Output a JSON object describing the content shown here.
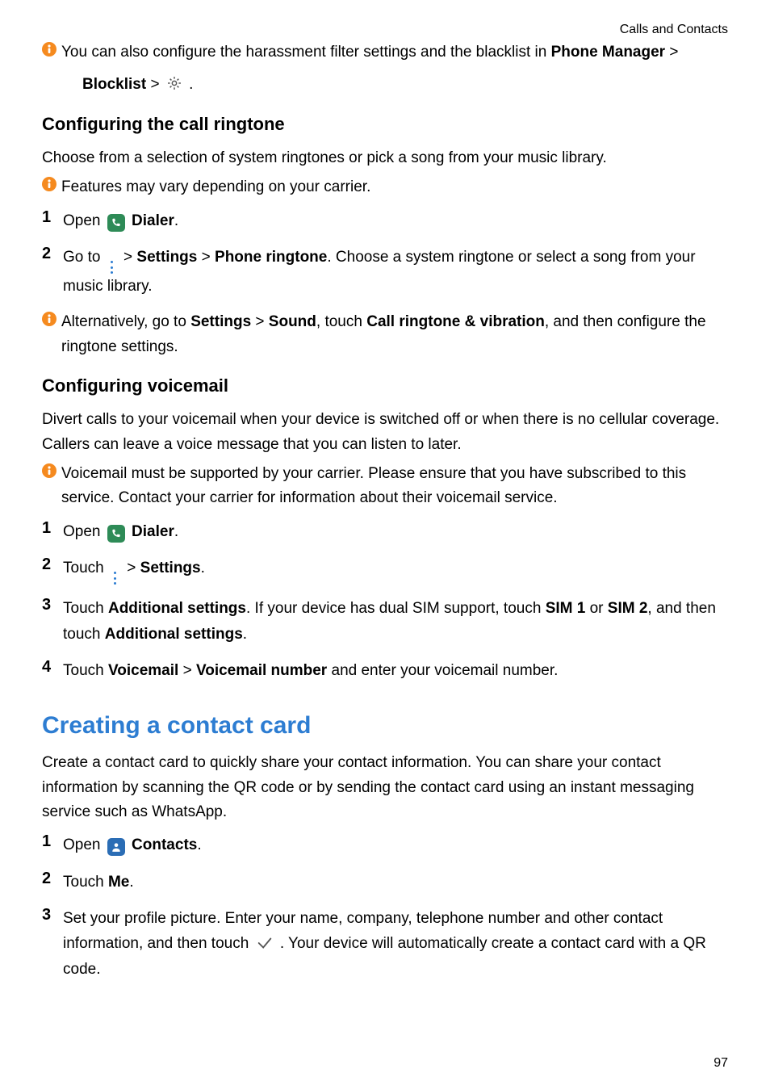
{
  "header": {
    "chapter": "Calls and Contacts"
  },
  "tip1": {
    "pre": "You can also configure the harassment filter settings and the blacklist in ",
    "b1": "Phone Manager",
    "sep1": " > ",
    "b2": "Blocklist",
    "sep2": " > ",
    "post": " ."
  },
  "ringtone": {
    "heading": "Configuring the call ringtone",
    "intro": "Choose from a selection of system ringtones or pick a song from your music library.",
    "tip": "Features may vary depending on your carrier.",
    "step1": {
      "pre": "Open ",
      "b": "Dialer",
      "post": "."
    },
    "step2": {
      "pre": "Go to ",
      "b1": "Settings",
      "b2": "Phone ringtone",
      "post": ". Choose a system ringtone or select a song from your music library."
    },
    "tip2": {
      "pre": "Alternatively, go to ",
      "b1": "Settings",
      "sep": " > ",
      "b2": "Sound",
      "mid": ", touch ",
      "b3": "Call ringtone & vibration",
      "post": ", and then configure the ringtone settings."
    }
  },
  "voicemail": {
    "heading": "Configuring voicemail",
    "intro": "Divert calls to your voicemail when your device is switched off or when there is no cellular coverage. Callers can leave a voice message that you can listen to later.",
    "tip": "Voicemail must be supported by your carrier. Please ensure that you have subscribed to this service. Contact your carrier for information about their voicemail service.",
    "step1": {
      "pre": "Open ",
      "b": "Dialer",
      "post": "."
    },
    "step2": {
      "pre": "Touch ",
      "b": "Settings",
      "post": "."
    },
    "step3": {
      "pre": "Touch ",
      "b1": "Additional settings",
      "mid": ". If your device has dual SIM support, touch ",
      "b2": "SIM 1",
      "or": " or ",
      "b3": "SIM 2",
      "mid2": ", and then touch ",
      "b4": "Additional settings",
      "post": "."
    },
    "step4": {
      "pre": "Touch ",
      "b1": "Voicemail",
      "sep": " > ",
      "b2": "Voicemail number",
      "post": " and enter your voicemail number."
    }
  },
  "contactCard": {
    "heading": "Creating a contact card",
    "intro": "Create a contact card to quickly share your contact information. You can share your contact information by scanning the QR code or by sending the contact card using an instant messaging service such as WhatsApp.",
    "step1": {
      "pre": "Open ",
      "b": "Contacts",
      "post": "."
    },
    "step2": {
      "pre": "Touch ",
      "b": "Me",
      "post": "."
    },
    "step3": {
      "pre": "Set your profile picture. Enter your name, company, telephone number and other contact information, and then touch ",
      "post": " . Your device will automatically create a contact card with a QR code."
    }
  },
  "nums": {
    "n1": "1",
    "n2": "2",
    "n3": "3",
    "n4": "4"
  },
  "sep": {
    "gt": " > "
  },
  "pageNumber": "97"
}
